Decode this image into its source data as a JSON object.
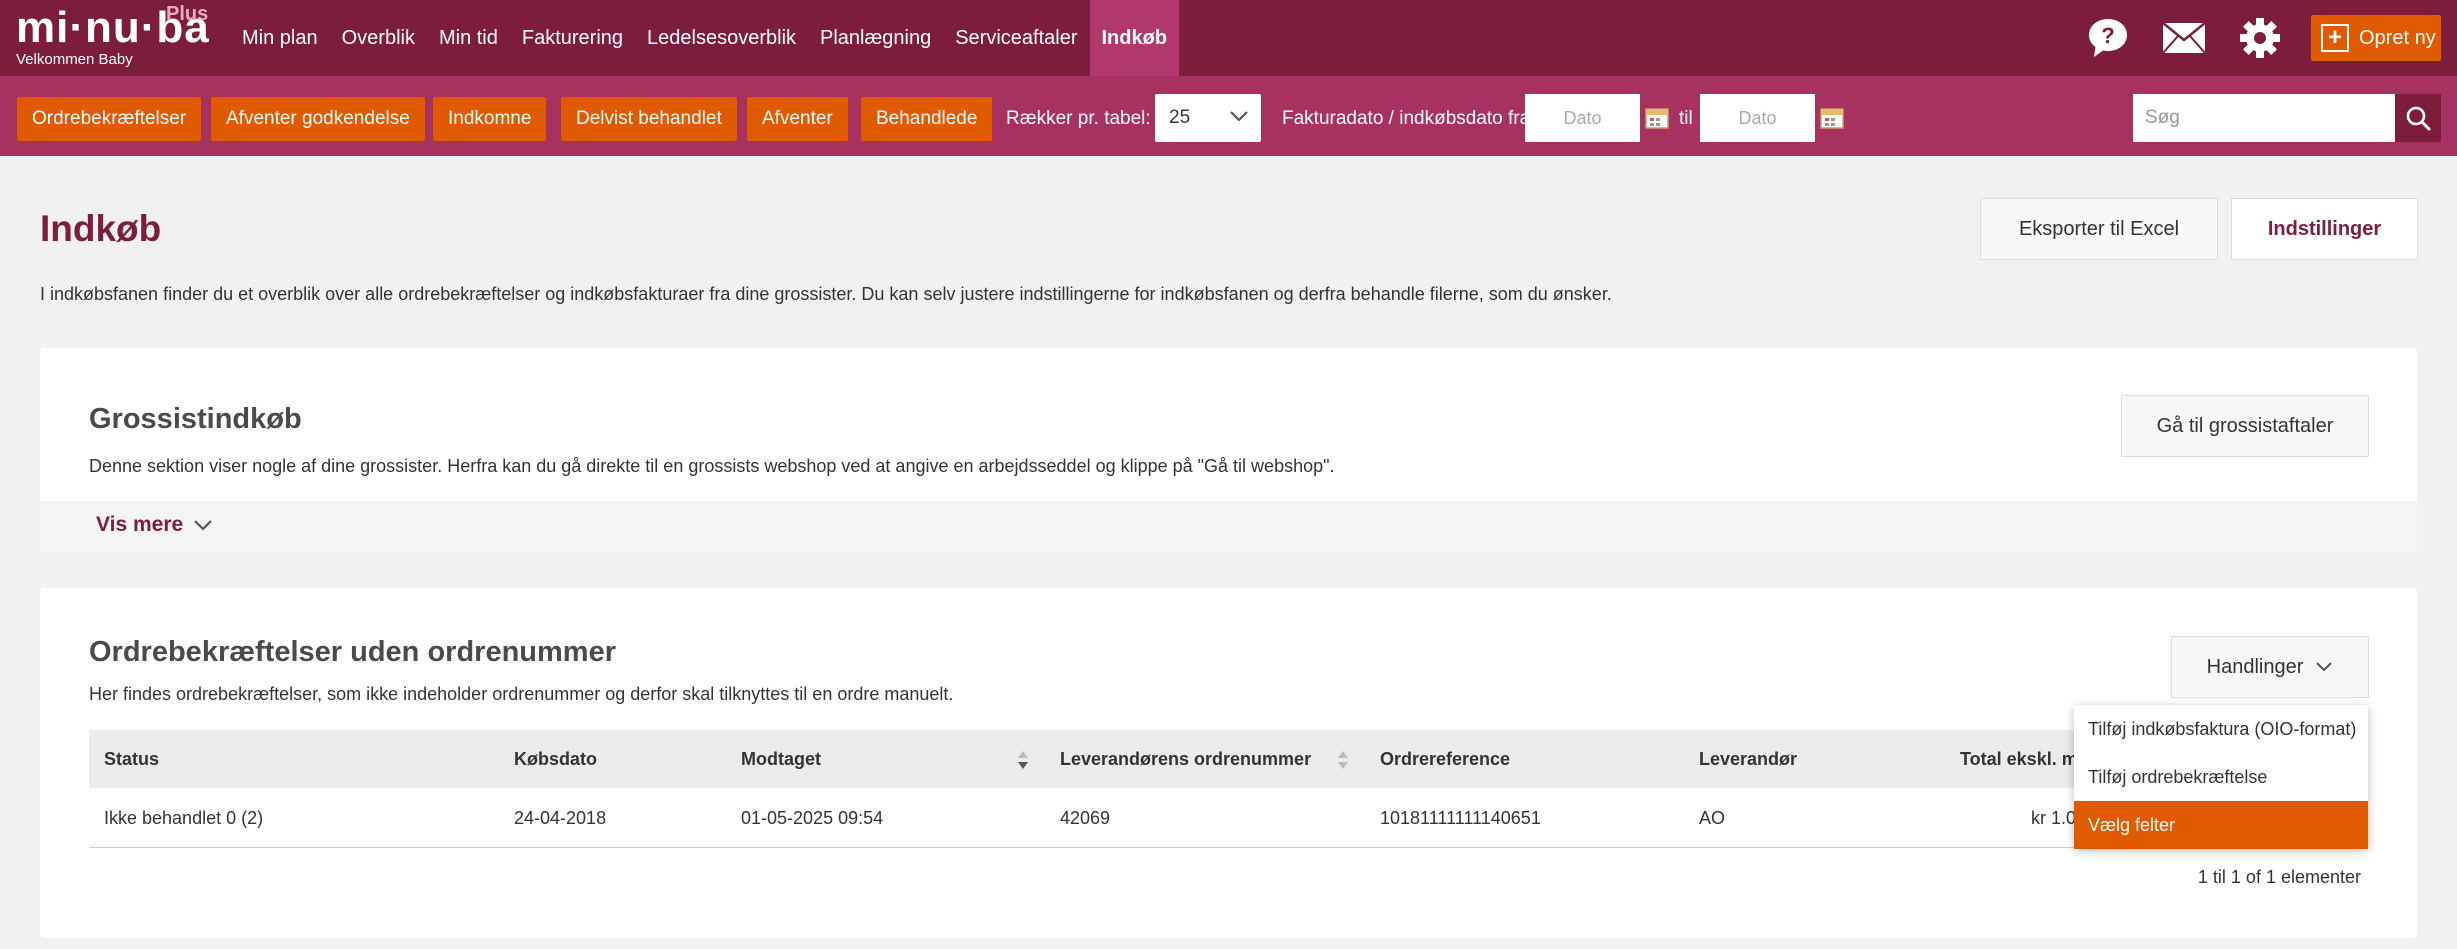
{
  "brand": {
    "logo": "mi·nu·ba",
    "plus": "Plus",
    "welcome": "Velkommen Baby"
  },
  "nav": {
    "items": [
      {
        "label": "Min plan"
      },
      {
        "label": "Overblik"
      },
      {
        "label": "Min tid"
      },
      {
        "label": "Fakturering"
      },
      {
        "label": "Ledelsesoverblik"
      },
      {
        "label": "Planlægning"
      },
      {
        "label": "Serviceaftaler"
      },
      {
        "label": "Indkøb",
        "active": true
      }
    ],
    "icons": [
      "help-icon",
      "mail-icon",
      "gear-icon"
    ],
    "create_label": "Opret ny"
  },
  "filters": {
    "buttons": [
      "Ordrebekræftelser",
      "Afventer godkendelse",
      "Indkomne",
      "Delvist behandlet",
      "Afventer",
      "Behandlede"
    ],
    "rows_label": "Rækker pr. tabel:",
    "rows_value": "25",
    "date_label": "Fakturadato / indkøbsdato fra",
    "date_from_placeholder": "Dato",
    "date_to_label": "til",
    "date_to_placeholder": "Dato",
    "search_placeholder": "Søg"
  },
  "page": {
    "title": "Indkøb",
    "description": "I indkøbsfanen finder du et overblik over alle ordrebekræftelser og indkøbsfakturaer fra dine grossister. Du kan selv justere indstillingerne for indkøbsfanen og derfra behandle filerne, som du ønsker.",
    "export_label": "Eksporter til Excel",
    "settings_label": "Indstillinger"
  },
  "grossist": {
    "title": "Grossistindkøb",
    "description": "Denne sektion viser nogle af dine grossister. Herfra kan du gå direkte til en grossists webshop ved at angive en arbejdsseddel og klippe på \"Gå til webshop\".",
    "button_label": "Gå til grossistaftaler",
    "more_label": "Vis mere"
  },
  "orders": {
    "title": "Ordrebekræftelser uden ordrenummer",
    "description": "Her findes ordrebekræftelser, som ikke indeholder ordrenummer og derfor skal tilknyttes til en ordre manuelt.",
    "actions_label": "Handlinger",
    "columns": [
      "Status",
      "Købsdato",
      "Modtaget",
      "Leverandørens ordrenummer",
      "Ordrereference",
      "Leverandør",
      "Total ekskl. m"
    ],
    "rows": [
      {
        "status": "Ikke behandlet 0 (2)",
        "date": "24-04-2018",
        "received": "01-05-2025 09:54",
        "supplier_order": "42069",
        "reference": "10181111111140651",
        "supplier": "AO",
        "total": "kr 1.0"
      }
    ],
    "pagination": "1 til 1 of 1 elementer"
  },
  "actions_menu": {
    "items": [
      {
        "label": "Tilføj indkøbsfaktura (OIO-format)"
      },
      {
        "label": "Tilføj ordrebekræftelse"
      },
      {
        "label": "Vælg felter",
        "active": true
      }
    ]
  },
  "colors": {
    "primary": "#7c1d3c",
    "secondary": "#a8325f",
    "accent": "#e05a00",
    "active_nav": "#b0386b"
  }
}
